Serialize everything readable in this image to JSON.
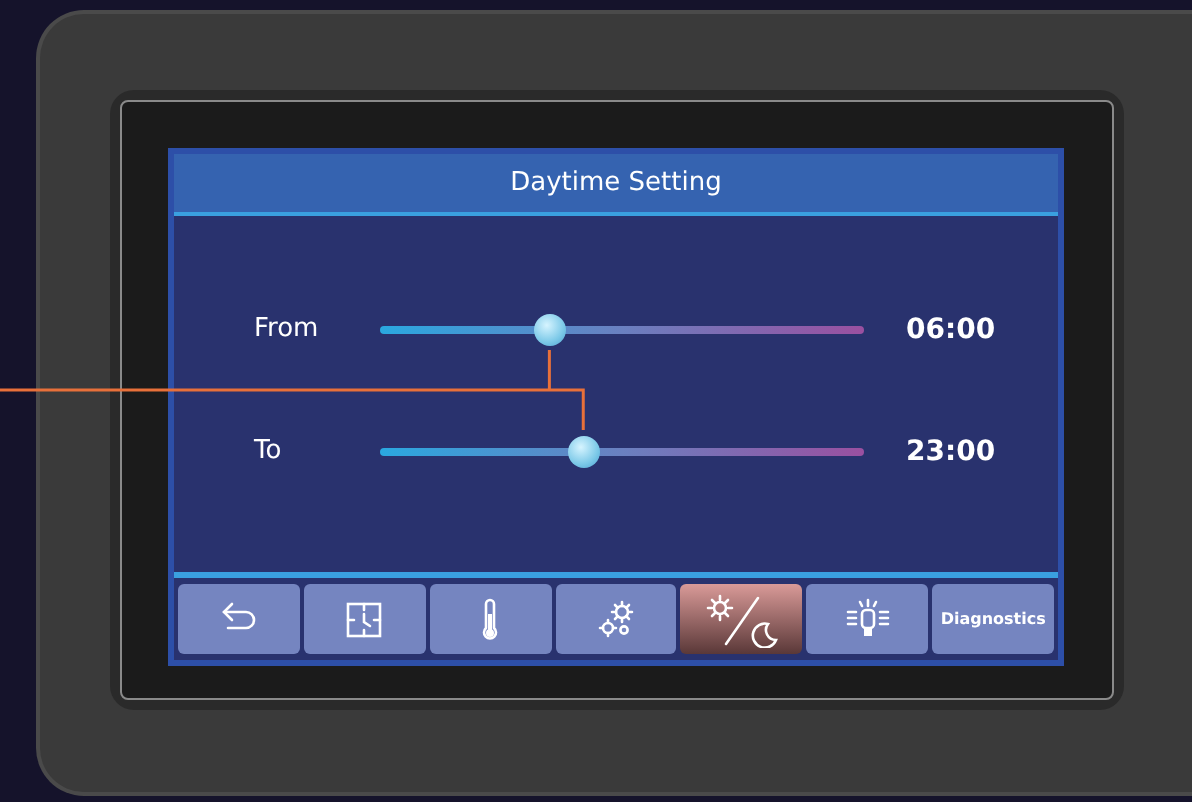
{
  "screen": {
    "title": "Daytime Setting",
    "sliders": [
      {
        "label": "From",
        "level": 0.35,
        "reading": "06:00"
      },
      {
        "label": "To",
        "level": 0.42,
        "reading": "23:00"
      }
    ],
    "toolbar": [
      {
        "kind": "back",
        "selected": false
      },
      {
        "kind": "clock",
        "selected": false
      },
      {
        "kind": "temperature",
        "selected": false
      },
      {
        "kind": "settings",
        "selected": false
      },
      {
        "kind": "daynight",
        "selected": true
      },
      {
        "kind": "light",
        "selected": false
      },
      {
        "kind": "text",
        "label": "Diagnostics",
        "selected": false
      }
    ]
  }
}
